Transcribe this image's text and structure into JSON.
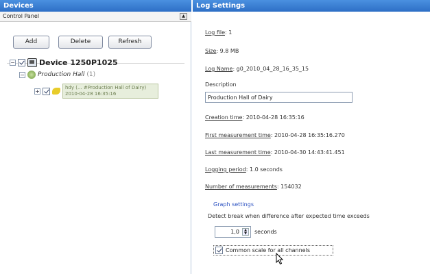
{
  "left_panel": {
    "title": "Devices",
    "combo": "Control Panel",
    "buttons": {
      "add": "Add",
      "delete": "Delete",
      "refresh": "Refresh"
    },
    "tree": {
      "device": "Device 1250P1025",
      "hall": "Production Hall",
      "hall_count": "(1)",
      "log_line1": "hdy (... #Production Hall of Dairy)",
      "log_line2": "2010-04-28 16:35:16"
    }
  },
  "right_panel": {
    "title": "Log Settings",
    "log_file_label": "Log file",
    "log_file_value": ": 1",
    "size_label": "Size",
    "size_value": ": 9.8 MB",
    "log_name_label": "Log Name",
    "log_name_value": ": g0_2010_04_28_16_35_15",
    "description_label": "Description",
    "description_value": "Production Hall of Dairy",
    "creation_time_label": "Creation time",
    "creation_time_value": ": 2010-04-28 16:35:16",
    "first_measurement_label": "First measurement time",
    "first_measurement_value": ": 2010-04-28 16:35:16.270",
    "last_measurement_label": "Last measurement time",
    "last_measurement_value": ": 2010-04-30 14:43:41.451",
    "logging_period_label": "Logging period",
    "logging_period_value": ": 1.0 seconds",
    "num_measurements_label": "Number of measurements",
    "num_measurements_value": ": 154032",
    "graph_settings": "Graph settings",
    "detect_break_text": "Detect break when difference after expected time exceeds",
    "threshold_value": "1,0",
    "threshold_unit": "seconds",
    "common_scale_label": "Common scale for all channels"
  }
}
